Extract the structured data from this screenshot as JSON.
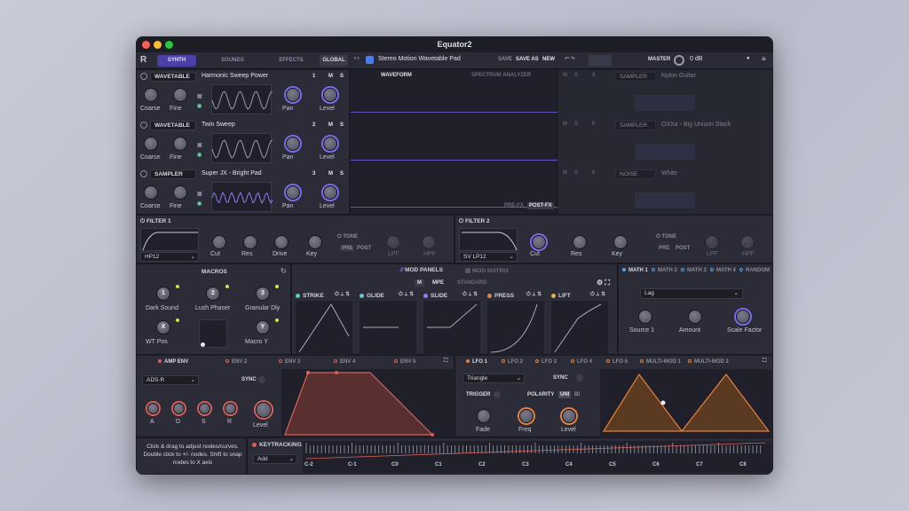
{
  "window_title": "Equator2",
  "topbar": {
    "tabs": [
      "SYNTH",
      "SOUNDS",
      "EFFECTS"
    ],
    "global": "GLOBAL",
    "preset_name": "Stereo Motion Wavetable Pad",
    "save": "SAVE",
    "save_as": "SAVE AS",
    "new": "NEW",
    "master_label": "MASTER",
    "master_value": "0 dB"
  },
  "oscillators": [
    {
      "type": "WAVETABLE",
      "name": "Harmonic Sweep Power",
      "num": "1",
      "m": "M",
      "s": "S",
      "knobs": [
        "Coarse",
        "Fine",
        "Pan",
        "Level"
      ]
    },
    {
      "type": "WAVETABLE",
      "name": "Twin Sweep",
      "num": "2",
      "m": "M",
      "s": "S",
      "knobs": [
        "Coarse",
        "Fine",
        "Pan",
        "Level"
      ]
    },
    {
      "type": "SAMPLER",
      "name": "Super JX - Bright Pad",
      "num": "3",
      "m": "M",
      "s": "S",
      "knobs": [
        "Coarse",
        "Fine",
        "Pan",
        "Level"
      ]
    }
  ],
  "oscillators_right": [
    {
      "num": "4",
      "type": "SAMPLER",
      "name": "Nylon Guitar"
    },
    {
      "num": "5",
      "type": "SAMPLER",
      "name": "OXXa - Big Unison Stack"
    },
    {
      "num": "6",
      "type": "NOISE",
      "name": "White"
    }
  ],
  "waveform": {
    "tab1": "WAVEFORM",
    "tab2": "SPECTRUM ANALYZER",
    "pre": "PRE-FX",
    "post": "POST-FX"
  },
  "filter1": {
    "title": "FILTER 1",
    "type": "HP12",
    "knobs": [
      "Cut",
      "Res",
      "Drive",
      "Key"
    ],
    "tone": "TONE",
    "pre": "PRE",
    "post": "POST",
    "low": "LPF",
    "high": "HPF"
  },
  "filter2": {
    "title": "FILTER 2",
    "type": "SV LP12",
    "knobs": [
      "Cut",
      "Res",
      "Key"
    ],
    "tone": "TONE",
    "pre": "PRE",
    "post": "POST",
    "low": "LPF",
    "high": "HPF"
  },
  "macros": {
    "title": "MACROS",
    "items": [
      {
        "n": "1",
        "label": "Dark Sound"
      },
      {
        "n": "2",
        "label": "Lush Phaser"
      },
      {
        "n": "3",
        "label": "Granular Dly"
      },
      {
        "n": "X",
        "label": "WT Pos"
      },
      {
        "n": "Y",
        "label": "Macro Y"
      }
    ]
  },
  "mod": {
    "tab1": "MOD PANELS",
    "tab2": "MOD MATRIX",
    "mpe": "MPE",
    "standard": "STANDARD",
    "panels": [
      "STRIKE",
      "GLIDE",
      "SLIDE",
      "PRESS",
      "LIFT"
    ]
  },
  "math": {
    "tabs": [
      "MATH 1",
      "MATH 2",
      "MATH 3",
      "MATH 4",
      "RANDOM"
    ],
    "mode": "Lag",
    "knobs": [
      "Source 1",
      "Amount",
      "Scale Factor"
    ]
  },
  "env": {
    "tabs": [
      "AMP ENV",
      "ENV 2",
      "ENV 3",
      "ENV 4",
      "ENV 5"
    ],
    "mode": "ADS-R",
    "sync": "SYNC",
    "knobs": [
      "A",
      "D",
      "S",
      "R"
    ],
    "level": "Level"
  },
  "lfo": {
    "tabs": [
      "LFO 1",
      "LFO 2",
      "LFO 3",
      "LFO 4",
      "LFO 5",
      "MULTI-MOD 1",
      "MULTI-MOD 2"
    ],
    "shape": "Triangle",
    "sync": "SYNC",
    "trigger": "TRIGGER",
    "polarity": "POLARITY",
    "uni": "UNI",
    "bi": "BI",
    "knobs": [
      "Fade",
      "Freq",
      "Level"
    ]
  },
  "help": "Click & drag to adjust nodes/curves. Double click to +/- nodes. Shift to snap nodes to X axis",
  "keytracking": {
    "title": "KEYTRACKING",
    "mode": "Add",
    "notes": [
      "C-2",
      "C-1",
      "C0",
      "C1",
      "C2",
      "C3",
      "C4",
      "C5",
      "C6",
      "C7",
      "C8"
    ]
  },
  "colors": {
    "accent": "#7c6df0",
    "red": "#d8625a",
    "orange": "#e8813b"
  }
}
